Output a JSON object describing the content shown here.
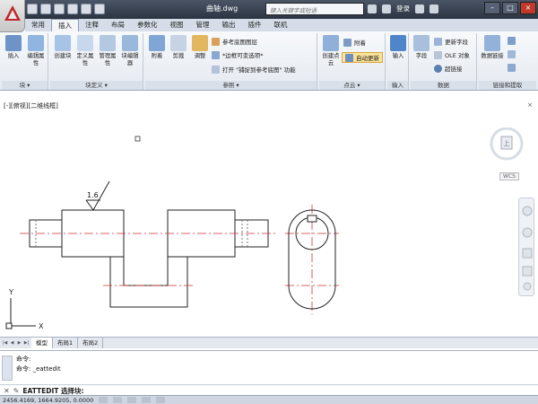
{
  "titlebar": {
    "doc_title": "曲轴.dwg",
    "search_placeholder": "键入关键字或短语",
    "login_label": "登录"
  },
  "tabs": [
    {
      "label": "常用",
      "active": false
    },
    {
      "label": "插入",
      "active": true
    },
    {
      "label": "注释",
      "active": false
    },
    {
      "label": "布局",
      "active": false
    },
    {
      "label": "参数化",
      "active": false
    },
    {
      "label": "视图",
      "active": false
    },
    {
      "label": "管理",
      "active": false
    },
    {
      "label": "输出",
      "active": false
    },
    {
      "label": "插件",
      "active": false
    },
    {
      "label": "联机",
      "active": false
    }
  ],
  "ribbon": {
    "block_panel": {
      "label": "块 ▾",
      "insert": "插入",
      "edit_attr": "编辑属性"
    },
    "blockdef_panel": {
      "label": "块定义 ▾",
      "create": "创建块",
      "define_attr": "定义属性",
      "manage_attr": "管理属性",
      "block_editor": "块编辑器"
    },
    "reference_panel": {
      "label": "参照 ▾",
      "attach": "附着",
      "clip": "剪裁",
      "adjust": "调整",
      "underlay_layers": "参考底图图层",
      "frames": "*边框可变选项*",
      "snap_underlay": "打开 \"捕捉到参考底图\" 功能"
    },
    "pointcloud_panel": {
      "label": "点云 ▾",
      "create": "创建点云",
      "attach": "附着",
      "auto_update": "自动更新"
    },
    "import_panel": {
      "label": "输入",
      "import": "输入"
    },
    "data_panel": {
      "label": "数据",
      "field": "字段",
      "update_fields": "更新字段",
      "ole_object": "OLE 对象",
      "hyperlink": "超链接"
    },
    "linking_panel": {
      "label": "链接和提取",
      "data_link": "数据链接"
    }
  },
  "drawing": {
    "view_label": "[-][俯视][二维线框]",
    "close_x": "×",
    "wcs_label": "WCS",
    "cube_face": "上",
    "roughness_value": "1.6",
    "ucs_y": "Y",
    "ucs_x": "X"
  },
  "layout_tabs": [
    {
      "label": "模型",
      "active": true
    },
    {
      "label": "布局1",
      "active": false
    },
    {
      "label": "布局2",
      "active": false
    }
  ],
  "command": {
    "line1": "命令:",
    "line2": "命令:  _eattedit",
    "prompt": "EATTEDIT 选择块:"
  },
  "status": {
    "coords": "2456.4169, 1664.9205, 0.0000"
  }
}
